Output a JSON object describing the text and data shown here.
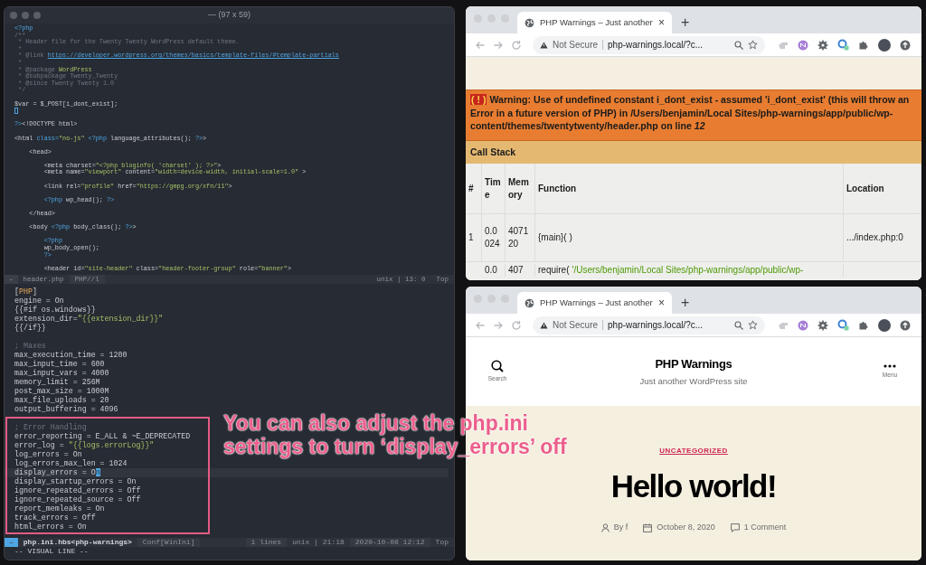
{
  "terminal": {
    "title": "— (97 x 59)",
    "top_pane": {
      "lines": [
        {
          "kind": "code",
          "segments": [
            {
              "kind": "kw",
              "text": "<?php"
            }
          ]
        },
        {
          "kind": "code",
          "segments": [
            {
              "kind": "com",
              "text": "/**"
            }
          ]
        },
        {
          "kind": "code",
          "segments": [
            {
              "kind": "com",
              "text": " * Header file for the Twenty Twenty WordPress default theme."
            }
          ]
        },
        {
          "kind": "code",
          "segments": [
            {
              "kind": "com",
              "text": " *"
            }
          ]
        },
        {
          "kind": "code",
          "segments": [
            {
              "kind": "com",
              "text": " * @link "
            },
            {
              "kind": "link",
              "text": "https://developer.wordpress.org/themes/basics/template-files/#template-partials"
            }
          ]
        },
        {
          "kind": "code",
          "segments": [
            {
              "kind": "com",
              "text": " *"
            }
          ]
        },
        {
          "kind": "code",
          "segments": [
            {
              "kind": "com",
              "text": " * @package "
            },
            {
              "kind": "str",
              "text": "WordPress"
            }
          ]
        },
        {
          "kind": "code",
          "segments": [
            {
              "kind": "com",
              "text": " * @subpackage Twenty_Twenty"
            }
          ]
        },
        {
          "kind": "code",
          "segments": [
            {
              "kind": "com",
              "text": " * @since Twenty Twenty 1.0"
            }
          ]
        },
        {
          "kind": "code",
          "segments": [
            {
              "kind": "com",
              "text": " */"
            }
          ]
        },
        {
          "kind": "blank"
        },
        {
          "kind": "code",
          "segments": [
            {
              "kind": "txt",
              "text": "$var = $_POST[i_dont_exist];"
            }
          ]
        },
        {
          "kind": "cursor"
        },
        {
          "kind": "blank"
        },
        {
          "kind": "code",
          "segments": [
            {
              "kind": "kw",
              "text": "?>"
            },
            {
              "kind": "txt",
              "text": "<!DOCTYPE html>"
            }
          ]
        },
        {
          "kind": "blank"
        },
        {
          "kind": "code",
          "segments": [
            {
              "kind": "txt",
              "text": "<html "
            },
            {
              "kind": "kw",
              "text": "class="
            },
            {
              "kind": "str",
              "text": "\"no-js\" "
            },
            {
              "kind": "kw",
              "text": "<?php"
            },
            {
              "kind": "txt",
              "text": " language_attributes(); "
            },
            {
              "kind": "kw",
              "text": "?>"
            },
            {
              "kind": "txt",
              "text": ">"
            }
          ]
        },
        {
          "kind": "blank"
        },
        {
          "kind": "code",
          "segments": [
            {
              "kind": "txt",
              "text": "    <head>"
            }
          ]
        },
        {
          "kind": "blank"
        },
        {
          "kind": "code",
          "segments": [
            {
              "kind": "txt",
              "text": "        <meta charset="
            },
            {
              "kind": "str",
              "text": "\"<?php bloginfo( 'charset' ); ?>\""
            },
            {
              "kind": "txt",
              "text": ">"
            }
          ]
        },
        {
          "kind": "code",
          "segments": [
            {
              "kind": "txt",
              "text": "        <meta name="
            },
            {
              "kind": "str",
              "text": "\"viewport\""
            },
            {
              "kind": "txt",
              "text": " content="
            },
            {
              "kind": "str",
              "text": "\"width=device-width, initial-scale=1.0\""
            },
            {
              "kind": "txt",
              "text": " >"
            }
          ]
        },
        {
          "kind": "blank"
        },
        {
          "kind": "code",
          "segments": [
            {
              "kind": "txt",
              "text": "        <link rel="
            },
            {
              "kind": "str",
              "text": "\"profile\""
            },
            {
              "kind": "txt",
              "text": " href="
            },
            {
              "kind": "str",
              "text": "\"https://gmpg.org/xfn/11\""
            },
            {
              "kind": "txt",
              "text": ">"
            }
          ]
        },
        {
          "kind": "blank"
        },
        {
          "kind": "code",
          "segments": [
            {
              "kind": "kw",
              "text": "        <?php"
            },
            {
              "kind": "txt",
              "text": " wp_head(); "
            },
            {
              "kind": "kw",
              "text": "?>"
            }
          ]
        },
        {
          "kind": "blank"
        },
        {
          "kind": "code",
          "segments": [
            {
              "kind": "txt",
              "text": "    </head>"
            }
          ]
        },
        {
          "kind": "blank"
        },
        {
          "kind": "code",
          "segments": [
            {
              "kind": "txt",
              "text": "    <body "
            },
            {
              "kind": "kw",
              "text": "<?php"
            },
            {
              "kind": "txt",
              "text": " body_class(); "
            },
            {
              "kind": "kw",
              "text": "?>"
            },
            {
              "kind": "txt",
              "text": ">"
            }
          ]
        },
        {
          "kind": "blank"
        },
        {
          "kind": "code",
          "segments": [
            {
              "kind": "kw",
              "text": "        <?php"
            }
          ]
        },
        {
          "kind": "code",
          "segments": [
            {
              "kind": "txt",
              "text": "        wp_body_open();"
            }
          ]
        },
        {
          "kind": "code",
          "segments": [
            {
              "kind": "kw",
              "text": "        ?>"
            }
          ]
        },
        {
          "kind": "blank"
        },
        {
          "kind": "code",
          "segments": [
            {
              "kind": "txt",
              "text": "        <header id="
            },
            {
              "kind": "str",
              "text": "\"site-header\""
            },
            {
              "kind": "txt",
              "text": " class="
            },
            {
              "kind": "str",
              "text": "\"header-footer-group\""
            },
            {
              "kind": "txt",
              "text": " role="
            },
            {
              "kind": "str",
              "text": "\"banner\""
            },
            {
              "kind": "txt",
              "text": ">"
            }
          ]
        }
      ]
    },
    "top_status": {
      "mode": "–",
      "file": "header.php",
      "filetype": "PHP//l",
      "position": "unix | 13: 0",
      "scroll": "Top"
    },
    "bottom_pane": {
      "lines": [
        {
          "kind": "code",
          "segments": [
            {
              "kind": "txt",
              "text": "["
            },
            {
              "kind": "sec",
              "text": "PHP"
            },
            {
              "kind": "txt",
              "text": "]"
            }
          ]
        },
        {
          "kind": "code",
          "segments": [
            {
              "kind": "txt",
              "text": "engine = On"
            }
          ]
        },
        {
          "kind": "code",
          "segments": [
            {
              "kind": "txt",
              "text": "{{#if os.windows}}"
            }
          ]
        },
        {
          "kind": "code",
          "segments": [
            {
              "kind": "txt",
              "text": "extension_dir="
            },
            {
              "kind": "str",
              "text": "\"{{extension_dir}}\""
            }
          ]
        },
        {
          "kind": "code",
          "segments": [
            {
              "kind": "txt",
              "text": "{{/if}}"
            }
          ]
        },
        {
          "kind": "blank"
        },
        {
          "kind": "code",
          "segments": [
            {
              "kind": "com",
              "text": "; Maxes"
            }
          ]
        },
        {
          "kind": "code",
          "segments": [
            {
              "kind": "txt",
              "text": "max_execution_time = 1200"
            }
          ]
        },
        {
          "kind": "code",
          "segments": [
            {
              "kind": "txt",
              "text": "max_input_time = 600"
            }
          ]
        },
        {
          "kind": "code",
          "segments": [
            {
              "kind": "txt",
              "text": "max_input_vars = 4000"
            }
          ]
        },
        {
          "kind": "code",
          "segments": [
            {
              "kind": "txt",
              "text": "memory_limit = 256M"
            }
          ]
        },
        {
          "kind": "code",
          "segments": [
            {
              "kind": "txt",
              "text": "post_max_size = 1000M"
            }
          ]
        },
        {
          "kind": "code",
          "segments": [
            {
              "kind": "txt",
              "text": "max_file_uploads = 20"
            }
          ]
        },
        {
          "kind": "code",
          "segments": [
            {
              "kind": "txt",
              "text": "output_buffering = 4096"
            }
          ]
        },
        {
          "kind": "blank"
        },
        {
          "kind": "code",
          "segments": [
            {
              "kind": "com",
              "text": "; Error Handling"
            }
          ]
        },
        {
          "kind": "code",
          "segments": [
            {
              "kind": "txt",
              "text": "error_reporting = E_ALL & ~E_DEPRECATED"
            }
          ]
        },
        {
          "kind": "code",
          "segments": [
            {
              "kind": "txt",
              "text": "error_log = "
            },
            {
              "kind": "str",
              "text": "\"{{logs.errorLog}}\""
            }
          ]
        },
        {
          "kind": "code",
          "segments": [
            {
              "kind": "txt",
              "text": "log_errors = On"
            }
          ]
        },
        {
          "kind": "code",
          "segments": [
            {
              "kind": "txt",
              "text": "log_errors_max_len = 1024"
            }
          ]
        },
        {
          "kind": "current",
          "segments": [
            {
              "kind": "txt",
              "text": "display_errors = O"
            },
            {
              "kind": "cursor",
              "text": "n"
            }
          ]
        },
        {
          "kind": "code",
          "segments": [
            {
              "kind": "txt",
              "text": "display_startup_errors = On"
            }
          ]
        },
        {
          "kind": "code",
          "segments": [
            {
              "kind": "txt",
              "text": "ignore_repeated_errors = Off"
            }
          ]
        },
        {
          "kind": "code",
          "segments": [
            {
              "kind": "txt",
              "text": "ignore_repeated_source = Off"
            }
          ]
        },
        {
          "kind": "code",
          "segments": [
            {
              "kind": "txt",
              "text": "report_memleaks = On"
            }
          ]
        },
        {
          "kind": "code",
          "segments": [
            {
              "kind": "txt",
              "text": "track_errors = Off"
            }
          ]
        },
        {
          "kind": "code",
          "segments": [
            {
              "kind": "txt",
              "text": "html_errors = On"
            }
          ]
        }
      ]
    },
    "bottom_status": {
      "mode": "–",
      "file": "php.ini.hbs<php-warnings>",
      "filetype": "Conf[WinIni]",
      "selection": "1 lines",
      "position": "unix | 21:18",
      "timestamp": "2020-10-08 12:12",
      "scroll": "Top"
    },
    "command_line": "-- VISUAL LINE --"
  },
  "browsers": [
    {
      "tab": {
        "title": "PHP Warnings – Just another",
        "close": "×"
      },
      "new_tab": "+",
      "address": {
        "security": "Not Secure",
        "url": "php-warnings.local/?c..."
      },
      "page": {
        "kind": "error",
        "warning": {
          "badge": "( ! )",
          "message": "Warning: Use of undefined constant i_dont_exist - assumed 'i_dont_exist' (this will throw an Error in a future version of PHP) in /Users/benjamin/Local Sites/php-warnings/app/public/wp-content/themes/twentytwenty/header.php on line *12*"
        },
        "call_stack": {
          "title": "Call Stack",
          "columns": [
            "#",
            "Time",
            "Memory",
            "Function",
            "Location"
          ],
          "rows": [
            {
              "number": "1",
              "time": "0.0024",
              "memory": "407120",
              "function": "{main}( )",
              "location": ".../index.php:0"
            },
            {
              "time": "0.0",
              "memory": "407",
              "function": "require(",
              "function_arg": "'/Users/benjamin/Local Sites/php-warnings/app/public/wp-"
            }
          ]
        }
      }
    },
    {
      "tab": {
        "title": "PHP Warnings – Just another",
        "close": "×"
      },
      "new_tab": "+",
      "address": {
        "security": "Not Secure",
        "url": "php-warnings.local/?c..."
      },
      "page": {
        "kind": "post",
        "search_label": "Search",
        "site_title": "PHP Warnings",
        "tagline": "Just another WordPress site",
        "menu_label": "Menu",
        "category": "UNCATEGORIZED",
        "post_title": "Hello world!",
        "author": "By f",
        "date": "October 8, 2020",
        "comments": "1 Comment"
      }
    }
  ],
  "annotation": {
    "lines": [
      "You can also adjust the php.ini",
      "settings to turn ‘display_errors’ off"
    ]
  }
}
